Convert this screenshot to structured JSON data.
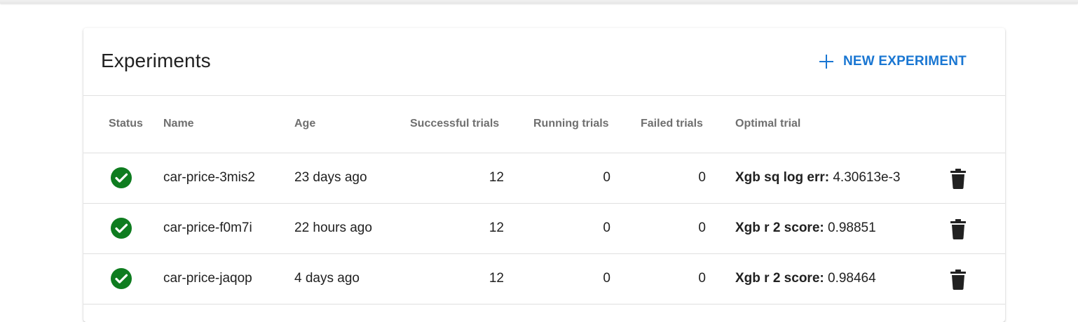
{
  "card": {
    "title": "Experiments",
    "new_button_label": "NEW EXPERIMENT"
  },
  "columns": {
    "status": "Status",
    "name": "Name",
    "age": "Age",
    "successful": "Successful trials",
    "running": "Running trials",
    "failed": "Failed trials",
    "optimal": "Optimal trial"
  },
  "rows": [
    {
      "status": "succeeded",
      "name": "car-price-3mis2",
      "age": "23 days ago",
      "successful": "12",
      "running": "0",
      "failed": "0",
      "metric": "Xgb sq log err:",
      "metric_value": "4.30613e-3"
    },
    {
      "status": "succeeded",
      "name": "car-price-f0m7i",
      "age": "22 hours ago",
      "successful": "12",
      "running": "0",
      "failed": "0",
      "metric": "Xgb r 2 score:",
      "metric_value": "0.98851"
    },
    {
      "status": "succeeded",
      "name": "car-price-jaqop",
      "age": "4 days ago",
      "successful": "12",
      "running": "0",
      "failed": "0",
      "metric": "Xgb r 2 score:",
      "metric_value": "0.98464"
    }
  ],
  "colors": {
    "accent": "#1976d2",
    "success": "#0e7c1f",
    "icon_dark": "#212121"
  },
  "icons": {
    "status": "check-circle-icon",
    "delete": "trash-icon",
    "add": "plus-icon"
  }
}
